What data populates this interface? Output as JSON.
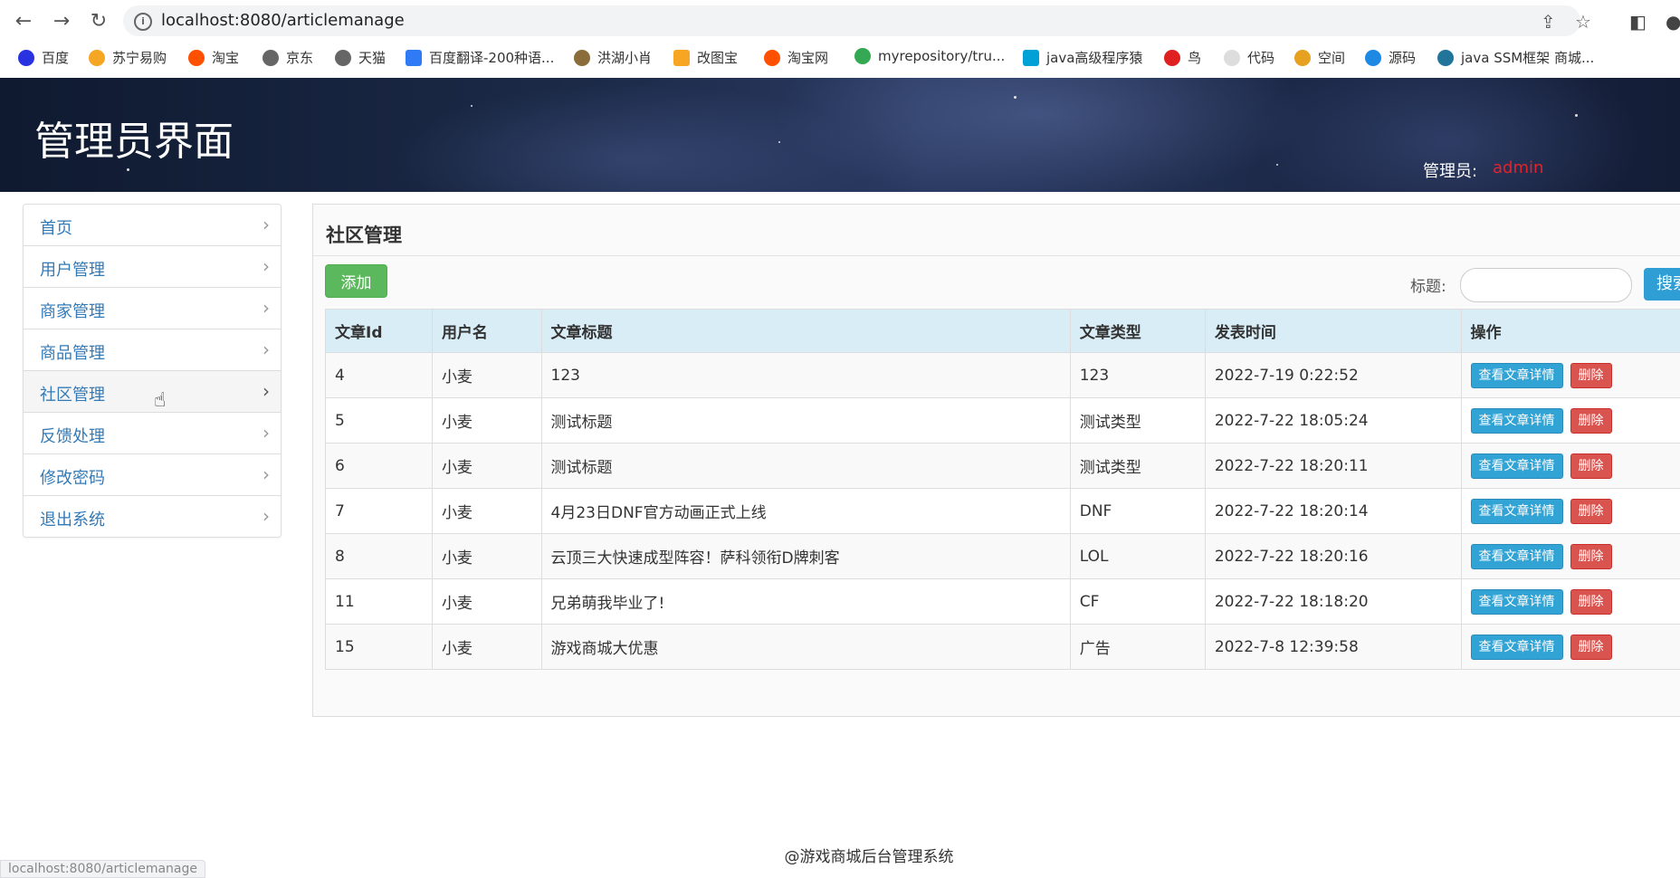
{
  "browser": {
    "url": "localhost:8080/articlemanage",
    "bookmarks": [
      "百度",
      "苏宁易购",
      "淘宝",
      "京东",
      "天猫",
      "百度翻译-200种语...",
      "洪湖小肖",
      "改图宝",
      "淘宝网",
      "myrepository/tru...",
      "java高级程序猿",
      "鸟",
      "代码",
      "空间",
      "源码",
      "java SSM框架 商城..."
    ],
    "status_url": "localhost:8080/articlemanage"
  },
  "header": {
    "title": "管理员界面",
    "admin_label": "管理员:",
    "admin_name": "admin"
  },
  "sidebar": {
    "items": [
      {
        "label": "首页"
      },
      {
        "label": "用户管理"
      },
      {
        "label": "商家管理"
      },
      {
        "label": "商品管理"
      },
      {
        "label": "社区管理"
      },
      {
        "label": "反馈处理"
      },
      {
        "label": "修改密码"
      },
      {
        "label": "退出系统"
      }
    ],
    "active_index": 4
  },
  "main": {
    "title": "社区管理",
    "add_label": "添加",
    "search_label": "标题:",
    "search_value": "",
    "search_button": "搜索",
    "columns": [
      "文章Id",
      "用户名",
      "文章标题",
      "文章类型",
      "发表时间",
      "操作"
    ],
    "detail_label": "查看文章详情",
    "delete_label": "删除",
    "rows": [
      {
        "id": "4",
        "user": "小麦",
        "title": "123",
        "type": "123",
        "time": "2022-7-19 0:22:52"
      },
      {
        "id": "5",
        "user": "小麦",
        "title": "测试标题",
        "type": "测试类型",
        "time": "2022-7-22 18:05:24"
      },
      {
        "id": "6",
        "user": "小麦",
        "title": "测试标题",
        "type": "测试类型",
        "time": "2022-7-22 18:20:11"
      },
      {
        "id": "7",
        "user": "小麦",
        "title": "4月23日DNF官方动画正式上线",
        "type": "DNF",
        "time": "2022-7-22 18:20:14"
      },
      {
        "id": "8",
        "user": "小麦",
        "title": "云顶三大快速成型阵容！萨科领衔D牌刺客",
        "type": "LOL",
        "time": "2022-7-22 18:20:16"
      },
      {
        "id": "11",
        "user": "小麦",
        "title": "兄弟萌我毕业了!",
        "type": "CF",
        "time": "2022-7-22 18:18:20"
      },
      {
        "id": "15",
        "user": "小麦",
        "title": "游戏商城大优惠",
        "type": "广告",
        "time": "2022-7-8 12:39:58"
      }
    ]
  },
  "footer": {
    "text": "@游戏商城后台管理系统"
  },
  "colors": {
    "link": "#337ab7",
    "success": "#5cb85c",
    "info": "#31a3d5",
    "danger": "#d9534f",
    "admin_name": "#e3232b",
    "table_header": "#d9edf7"
  }
}
